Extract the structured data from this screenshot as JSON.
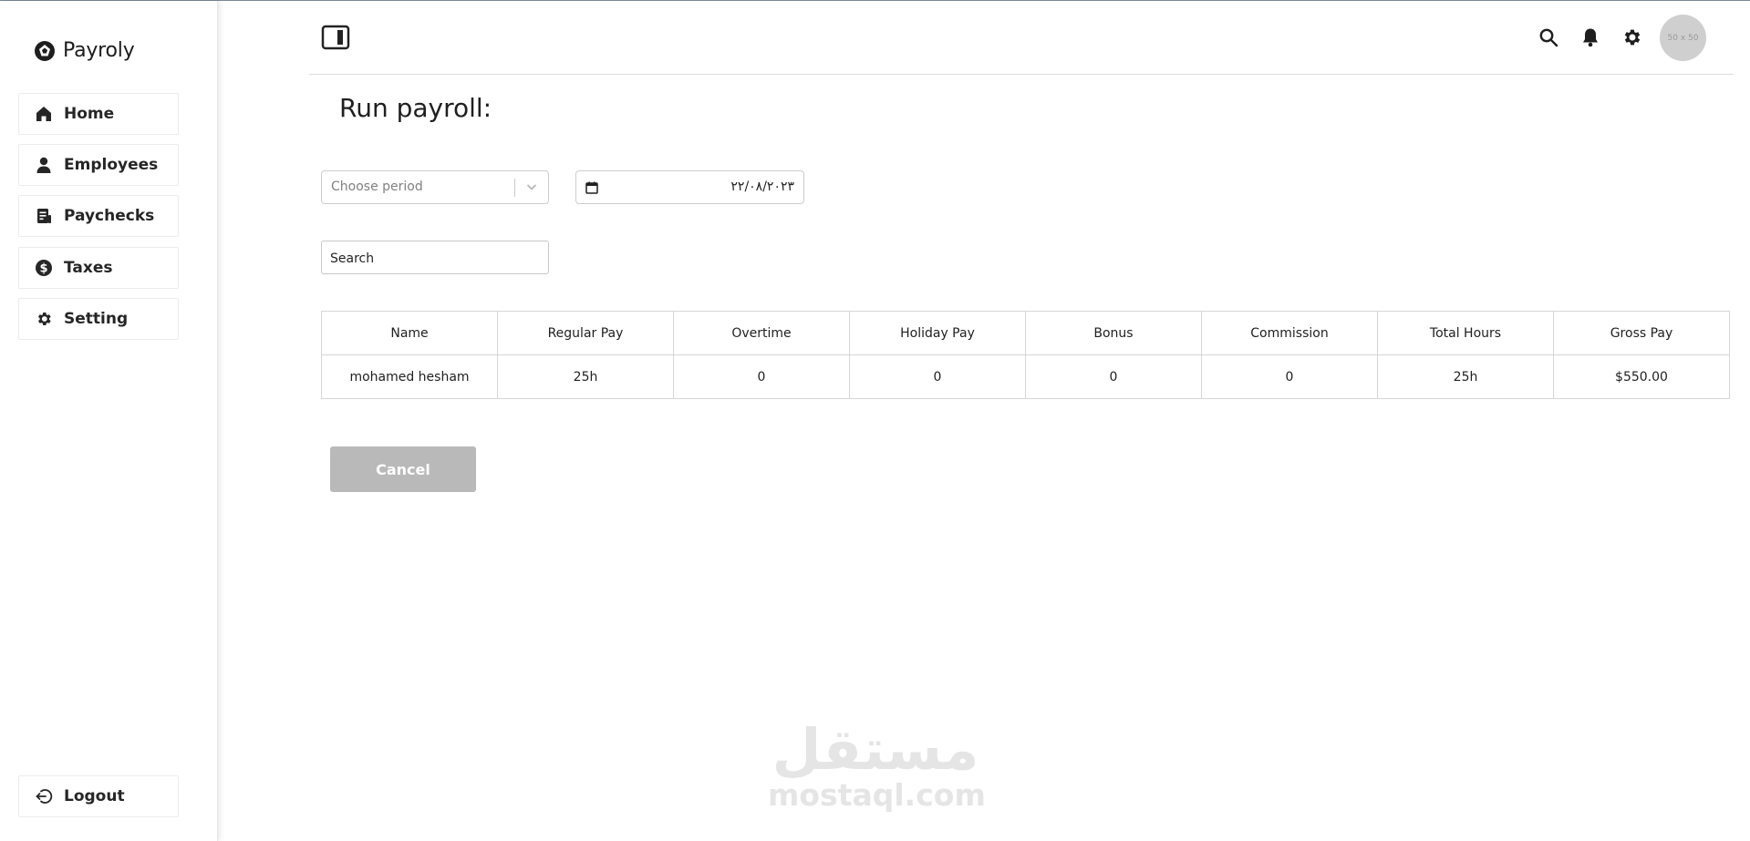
{
  "brand": {
    "name": "Payroly"
  },
  "sidebar": {
    "items": [
      {
        "label": "Home",
        "icon": "home-icon"
      },
      {
        "label": "Employees",
        "icon": "user-icon"
      },
      {
        "label": "Paychecks",
        "icon": "paycheck-icon"
      },
      {
        "label": "Taxes",
        "icon": "dollar-icon"
      },
      {
        "label": "Setting",
        "icon": "gear-icon"
      }
    ],
    "logout": {
      "label": "Logout",
      "icon": "logout-icon"
    }
  },
  "header": {
    "icons": [
      "sidebar-toggle-icon",
      "search-icon",
      "bell-icon",
      "gear-icon"
    ],
    "avatar_text": "50 x 50"
  },
  "page": {
    "title": "Run payroll:",
    "period_placeholder": "Choose period",
    "date_value": "٢٢/٠٨/٢٠٢٣",
    "search_placeholder": "Search"
  },
  "table": {
    "columns": [
      "Name",
      "Regular Pay",
      "Overtime",
      "Holiday Pay",
      "Bonus",
      "Commission",
      "Total Hours",
      "Gross Pay"
    ],
    "rows": [
      [
        "mohamed hesham",
        "25h",
        "0",
        "0",
        "0",
        "0",
        "25h",
        "$550.00"
      ]
    ]
  },
  "actions": {
    "cancel_label": "Cancel"
  },
  "watermark": {
    "arabic": "مستقل",
    "latin": "mostaql.com"
  },
  "colors": {
    "accent": "#262626",
    "cancel_bg": "#b9b9b9",
    "avatar_bg": "#cfcfcf"
  }
}
